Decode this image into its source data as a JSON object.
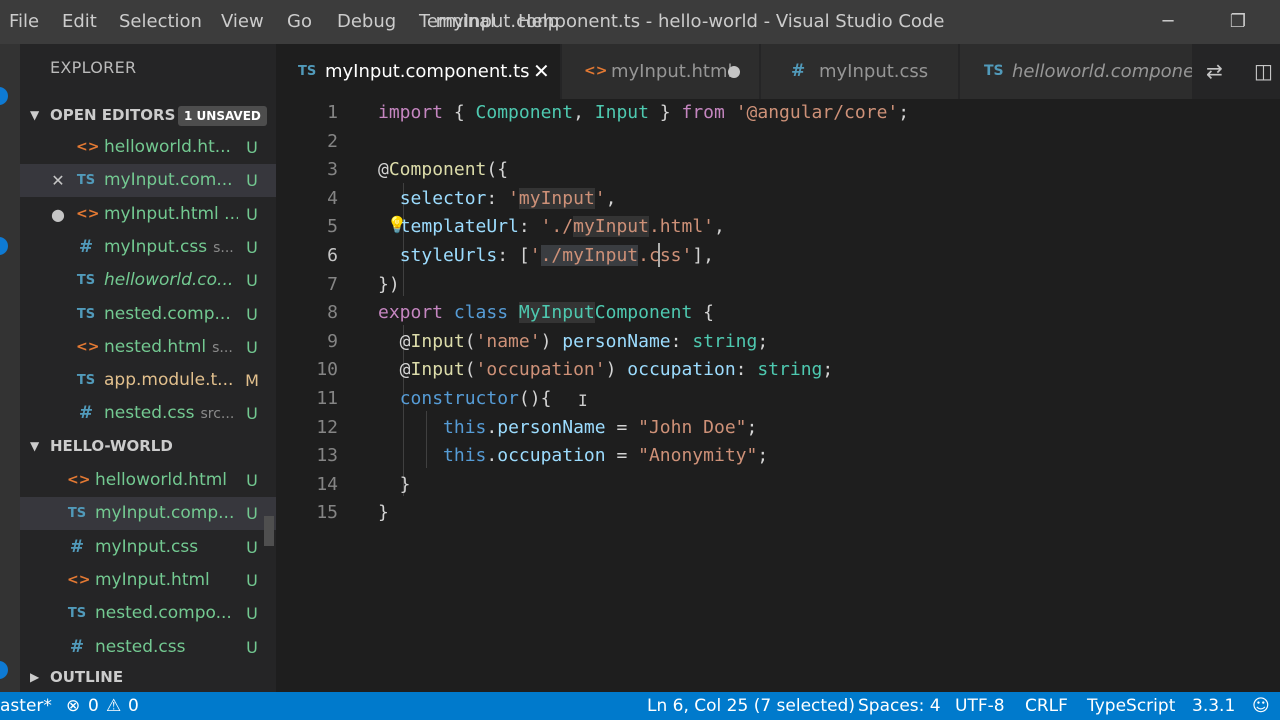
{
  "window": {
    "title": "myInput.component.ts - hello-world - Visual Studio Code",
    "menu": [
      "File",
      "Edit",
      "Selection",
      "View",
      "Go",
      "Debug",
      "Terminal",
      "Help"
    ],
    "minimize_icon": "minimize-icon",
    "restore_icon": "restore-icon"
  },
  "sidebar": {
    "title": "EXPLORER",
    "open_editors": {
      "label": "OPEN EDITORS",
      "badge": "1 UNSAVED",
      "items": [
        {
          "icon": "<>",
          "kind": "html",
          "name": "helloworld.ht...",
          "path": "",
          "status": "U",
          "lead": ""
        },
        {
          "icon": "TS",
          "kind": "ts",
          "name": "myInput.com...",
          "path": "",
          "status": "U",
          "lead": "✕"
        },
        {
          "icon": "<>",
          "kind": "html",
          "name": "myInput.html ...",
          "path": "",
          "status": "U",
          "lead": "●"
        },
        {
          "icon": "#",
          "kind": "css",
          "name": "myInput.css",
          "path": "s...",
          "status": "U",
          "lead": ""
        },
        {
          "icon": "TS",
          "kind": "ts",
          "name": "helloworld.co...",
          "path": "",
          "status": "U",
          "lead": ""
        },
        {
          "icon": "TS",
          "kind": "ts",
          "name": "nested.comp...",
          "path": "",
          "status": "U",
          "lead": ""
        },
        {
          "icon": "<>",
          "kind": "html",
          "name": "nested.html",
          "path": "s...",
          "status": "U",
          "lead": ""
        },
        {
          "icon": "TS",
          "kind": "ts",
          "name": "app.module.t...",
          "path": "",
          "status": "M",
          "lead": ""
        },
        {
          "icon": "#",
          "kind": "css",
          "name": "nested.css",
          "path": "src...",
          "status": "U",
          "lead": ""
        }
      ]
    },
    "project": {
      "label": "HELLO-WORLD",
      "items": [
        {
          "icon": "<>",
          "kind": "html",
          "name": "helloworld.html",
          "status": "U"
        },
        {
          "icon": "TS",
          "kind": "ts",
          "name": "myInput.comp...",
          "status": "U"
        },
        {
          "icon": "#",
          "kind": "css",
          "name": "myInput.css",
          "status": "U"
        },
        {
          "icon": "<>",
          "kind": "html",
          "name": "myInput.html",
          "status": "U"
        },
        {
          "icon": "TS",
          "kind": "ts",
          "name": "nested.compo...",
          "status": "U"
        },
        {
          "icon": "#",
          "kind": "css",
          "name": "nested.css",
          "status": "U"
        }
      ]
    },
    "outline": {
      "label": "OUTLINE"
    }
  },
  "tabs": [
    {
      "icon": "TS",
      "label": "myInput.component.ts",
      "active": true
    },
    {
      "icon": "<>",
      "label": "myInput.html",
      "dirty": true
    },
    {
      "icon": "#",
      "label": "myInput.css"
    },
    {
      "icon": "TS",
      "label": "helloworld.componen"
    }
  ],
  "editor": {
    "lines": [
      {
        "n": "1",
        "tokens": [
          [
            "kw",
            "import"
          ],
          [
            "pl",
            " { "
          ],
          [
            "cls",
            "Component"
          ],
          [
            "pl",
            ", "
          ],
          [
            "cls",
            "Input"
          ],
          [
            "pl",
            " } "
          ],
          [
            "kw",
            "from"
          ],
          [
            "pl",
            " "
          ],
          [
            "str",
            "'@angular/core'"
          ],
          [
            "pl",
            ";"
          ]
        ]
      },
      {
        "n": "2",
        "tokens": []
      },
      {
        "n": "3",
        "tokens": [
          [
            "pl",
            "@"
          ],
          [
            "fn",
            "Component"
          ],
          [
            "pl",
            "({"
          ]
        ]
      },
      {
        "n": "4",
        "tokens": [
          [
            "pl",
            "  "
          ],
          [
            "prop",
            "selector"
          ],
          [
            "pl",
            ": "
          ],
          [
            "str",
            "'"
          ],
          [
            "strsel",
            "myInput"
          ],
          [
            "str",
            "'"
          ],
          [
            "pl",
            ","
          ]
        ]
      },
      {
        "n": "5",
        "tokens": [
          [
            "pl",
            "  "
          ],
          [
            "prop",
            "templateUrl"
          ],
          [
            "pl",
            ": "
          ],
          [
            "str",
            "'./"
          ],
          [
            "strsel",
            "myInput"
          ],
          [
            "str",
            ".html'"
          ],
          [
            "pl",
            ","
          ]
        ]
      },
      {
        "n": "6",
        "tokens": [
          [
            "pl",
            "  "
          ],
          [
            "prop",
            "styleUrls"
          ],
          [
            "pl",
            ": ["
          ],
          [
            "str",
            "'"
          ],
          [
            "strsel",
            "./myInput"
          ],
          [
            "str",
            ".css'"
          ],
          [
            "pl",
            "],"
          ]
        ]
      },
      {
        "n": "7",
        "tokens": [
          [
            "pl",
            "})"
          ]
        ]
      },
      {
        "n": "8",
        "tokens": [
          [
            "kw",
            "export"
          ],
          [
            "pl",
            " "
          ],
          [
            "kwb",
            "class"
          ],
          [
            "pl",
            " "
          ],
          [
            "clssel",
            "MyInput"
          ],
          [
            "cls",
            "Component"
          ],
          [
            "pl",
            " {"
          ]
        ]
      },
      {
        "n": "9",
        "tokens": [
          [
            "pl",
            "  @"
          ],
          [
            "fn",
            "Input"
          ],
          [
            "pl",
            "("
          ],
          [
            "str",
            "'name'"
          ],
          [
            "pl",
            ") "
          ],
          [
            "prop",
            "personName"
          ],
          [
            "pl",
            ": "
          ],
          [
            "cls",
            "string"
          ],
          [
            "pl",
            ";"
          ]
        ]
      },
      {
        "n": "10",
        "tokens": [
          [
            "pl",
            "  @"
          ],
          [
            "fn",
            "Input"
          ],
          [
            "pl",
            "("
          ],
          [
            "str",
            "'occupation'"
          ],
          [
            "pl",
            ") "
          ],
          [
            "prop",
            "occupation"
          ],
          [
            "pl",
            ": "
          ],
          [
            "cls",
            "string"
          ],
          [
            "pl",
            ";"
          ]
        ]
      },
      {
        "n": "11",
        "tokens": [
          [
            "pl",
            "  "
          ],
          [
            "kwb",
            "constructor"
          ],
          [
            "pl",
            "(){"
          ]
        ]
      },
      {
        "n": "12",
        "tokens": [
          [
            "pl",
            "      "
          ],
          [
            "kwb",
            "this"
          ],
          [
            "pl",
            "."
          ],
          [
            "prop",
            "personName"
          ],
          [
            "pl",
            " = "
          ],
          [
            "str",
            "\"John Doe\""
          ],
          [
            "pl",
            ";"
          ]
        ]
      },
      {
        "n": "13",
        "tokens": [
          [
            "pl",
            "      "
          ],
          [
            "kwb",
            "this"
          ],
          [
            "pl",
            "."
          ],
          [
            "prop",
            "occupation"
          ],
          [
            "pl",
            " = "
          ],
          [
            "str",
            "\"Anonymity\""
          ],
          [
            "pl",
            ";"
          ]
        ]
      },
      {
        "n": "14",
        "tokens": [
          [
            "pl",
            "  }"
          ]
        ]
      },
      {
        "n": "15",
        "tokens": [
          [
            "pl",
            "}"
          ]
        ]
      }
    ],
    "current_line": "6"
  },
  "statusbar": {
    "branch": "aster*",
    "errors": "0",
    "warnings": "0",
    "position": "Ln 6, Col 25 (7 selected)",
    "spaces": "Spaces: 4",
    "encoding": "UTF-8",
    "eol": "CRLF",
    "language": "TypeScript",
    "version": "3.3.1"
  },
  "colors": {
    "accent": "#007acc",
    "untracked": "#73c991",
    "modified": "#e2c08d"
  }
}
